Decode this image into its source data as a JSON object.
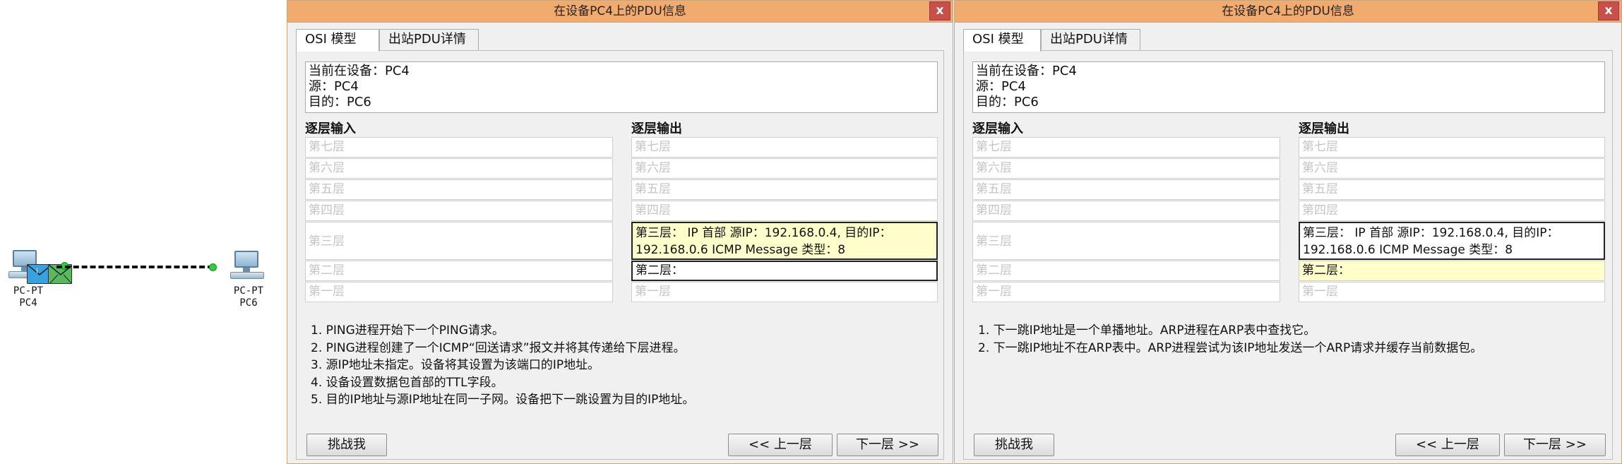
{
  "topology": {
    "pc4": {
      "type": "PC-PT",
      "name": "PC4"
    },
    "pc6": {
      "type": "PC-PT",
      "name": "PC6"
    }
  },
  "colors": {
    "titlebar": "#f2ab6e",
    "close": "#c7504b",
    "highlight": "#ffffcc",
    "link_dot": "#2ecc40"
  },
  "windows": [
    {
      "title": "在设备PC4上的PDU信息",
      "close_label": "x",
      "tabs": [
        {
          "label": "OSI 模型"
        },
        {
          "label": "出站PDU详情"
        }
      ],
      "info": {
        "current": "当前在设备：PC4",
        "source": "源：PC4",
        "dest": "目的：PC6"
      },
      "in_title": "逐层输入",
      "out_title": "逐层输出",
      "in_layers": [
        "第七层",
        "第六层",
        "第五层",
        "第四层",
        "第三层",
        "第二层",
        "第一层"
      ],
      "out_layers": [
        "第七层",
        "第六层",
        "第五层",
        "第四层",
        "第三层： IP 首部 源IP：192.168.0.4, 目的IP：192.168.0.6 ICMP Message 类型：8",
        "第二层：",
        "第一层"
      ],
      "notes": [
        "1. PING进程开始下一个PING请求。",
        "2. PING进程创建了一个ICMP“回送请求”报文并将其传递给下层进程。",
        "3. 源IP地址未指定。设备将其设置为该端口的IP地址。",
        "4. 设备设置数据包首部的TTL字段。",
        "5. 目的IP地址与源IP地址在同一子网。设备把下一跳设置为目的IP地址。"
      ],
      "challenge_btn": "挑战我",
      "prev_btn": "<< 上一层",
      "next_btn": "下一层 >>"
    },
    {
      "title": "在设备PC4上的PDU信息",
      "close_label": "x",
      "tabs": [
        {
          "label": "OSI 模型"
        },
        {
          "label": "出站PDU详情"
        }
      ],
      "info": {
        "current": "当前在设备：PC4",
        "source": "源：PC4",
        "dest": "目的：PC6"
      },
      "in_title": "逐层输入",
      "out_title": "逐层输出",
      "in_layers": [
        "第七层",
        "第六层",
        "第五层",
        "第四层",
        "第三层",
        "第二层",
        "第一层"
      ],
      "out_layers": [
        "第七层",
        "第六层",
        "第五层",
        "第四层",
        "第三层： IP 首部 源IP：192.168.0.4, 目的IP：192.168.0.6 ICMP Message 类型：8",
        "第二层：",
        "第一层"
      ],
      "notes": [
        "1. 下一跳IP地址是一个单播地址。ARP进程在ARP表中查找它。",
        "2. 下一跳IP地址不在ARP表中。ARP进程尝试为该IP地址发送一个ARP请求并缓存当前数据包。"
      ],
      "challenge_btn": "挑战我",
      "prev_btn": "<< 上一层",
      "next_btn": "下一层 >>"
    }
  ]
}
